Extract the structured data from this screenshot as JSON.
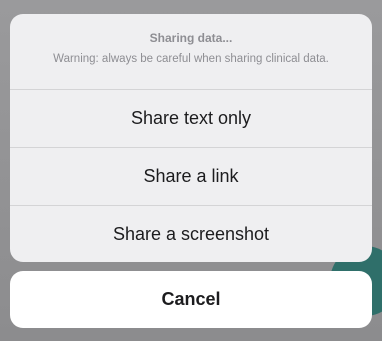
{
  "action_sheet": {
    "title": "Sharing data...",
    "message": "Warning: always be careful when sharing clinical data.",
    "actions": [
      {
        "label": "Share text only"
      },
      {
        "label": "Share a link"
      },
      {
        "label": "Share a screenshot"
      }
    ],
    "cancel_label": "Cancel"
  },
  "colors": {
    "sheet_background": "#efeff1",
    "cancel_background": "#ffffff",
    "header_text": "#8e8e93",
    "action_text": "#1c1c1e",
    "background_fab": "#2f6f6a"
  }
}
